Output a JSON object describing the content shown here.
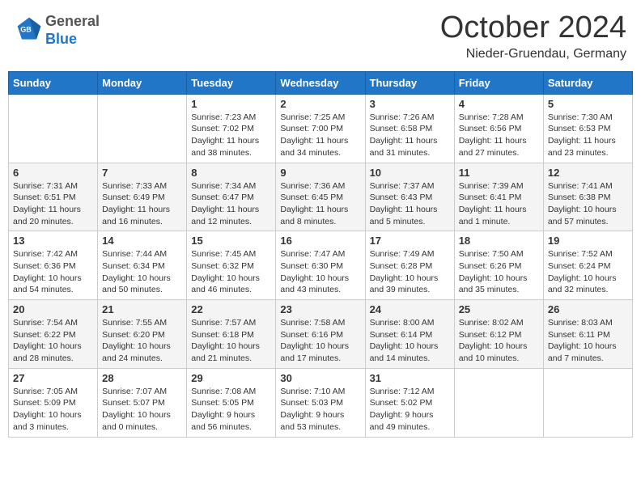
{
  "header": {
    "logo_text_general": "General",
    "logo_text_blue": "Blue",
    "month_title": "October 2024",
    "location": "Nieder-Gruendau, Germany"
  },
  "weekdays": [
    "Sunday",
    "Monday",
    "Tuesday",
    "Wednesday",
    "Thursday",
    "Friday",
    "Saturday"
  ],
  "weeks": [
    [
      {
        "day": "",
        "text": ""
      },
      {
        "day": "",
        "text": ""
      },
      {
        "day": "1",
        "text": "Sunrise: 7:23 AM\nSunset: 7:02 PM\nDaylight: 11 hours and 38 minutes."
      },
      {
        "day": "2",
        "text": "Sunrise: 7:25 AM\nSunset: 7:00 PM\nDaylight: 11 hours and 34 minutes."
      },
      {
        "day": "3",
        "text": "Sunrise: 7:26 AM\nSunset: 6:58 PM\nDaylight: 11 hours and 31 minutes."
      },
      {
        "day": "4",
        "text": "Sunrise: 7:28 AM\nSunset: 6:56 PM\nDaylight: 11 hours and 27 minutes."
      },
      {
        "day": "5",
        "text": "Sunrise: 7:30 AM\nSunset: 6:53 PM\nDaylight: 11 hours and 23 minutes."
      }
    ],
    [
      {
        "day": "6",
        "text": "Sunrise: 7:31 AM\nSunset: 6:51 PM\nDaylight: 11 hours and 20 minutes."
      },
      {
        "day": "7",
        "text": "Sunrise: 7:33 AM\nSunset: 6:49 PM\nDaylight: 11 hours and 16 minutes."
      },
      {
        "day": "8",
        "text": "Sunrise: 7:34 AM\nSunset: 6:47 PM\nDaylight: 11 hours and 12 minutes."
      },
      {
        "day": "9",
        "text": "Sunrise: 7:36 AM\nSunset: 6:45 PM\nDaylight: 11 hours and 8 minutes."
      },
      {
        "day": "10",
        "text": "Sunrise: 7:37 AM\nSunset: 6:43 PM\nDaylight: 11 hours and 5 minutes."
      },
      {
        "day": "11",
        "text": "Sunrise: 7:39 AM\nSunset: 6:41 PM\nDaylight: 11 hours and 1 minute."
      },
      {
        "day": "12",
        "text": "Sunrise: 7:41 AM\nSunset: 6:38 PM\nDaylight: 10 hours and 57 minutes."
      }
    ],
    [
      {
        "day": "13",
        "text": "Sunrise: 7:42 AM\nSunset: 6:36 PM\nDaylight: 10 hours and 54 minutes."
      },
      {
        "day": "14",
        "text": "Sunrise: 7:44 AM\nSunset: 6:34 PM\nDaylight: 10 hours and 50 minutes."
      },
      {
        "day": "15",
        "text": "Sunrise: 7:45 AM\nSunset: 6:32 PM\nDaylight: 10 hours and 46 minutes."
      },
      {
        "day": "16",
        "text": "Sunrise: 7:47 AM\nSunset: 6:30 PM\nDaylight: 10 hours and 43 minutes."
      },
      {
        "day": "17",
        "text": "Sunrise: 7:49 AM\nSunset: 6:28 PM\nDaylight: 10 hours and 39 minutes."
      },
      {
        "day": "18",
        "text": "Sunrise: 7:50 AM\nSunset: 6:26 PM\nDaylight: 10 hours and 35 minutes."
      },
      {
        "day": "19",
        "text": "Sunrise: 7:52 AM\nSunset: 6:24 PM\nDaylight: 10 hours and 32 minutes."
      }
    ],
    [
      {
        "day": "20",
        "text": "Sunrise: 7:54 AM\nSunset: 6:22 PM\nDaylight: 10 hours and 28 minutes."
      },
      {
        "day": "21",
        "text": "Sunrise: 7:55 AM\nSunset: 6:20 PM\nDaylight: 10 hours and 24 minutes."
      },
      {
        "day": "22",
        "text": "Sunrise: 7:57 AM\nSunset: 6:18 PM\nDaylight: 10 hours and 21 minutes."
      },
      {
        "day": "23",
        "text": "Sunrise: 7:58 AM\nSunset: 6:16 PM\nDaylight: 10 hours and 17 minutes."
      },
      {
        "day": "24",
        "text": "Sunrise: 8:00 AM\nSunset: 6:14 PM\nDaylight: 10 hours and 14 minutes."
      },
      {
        "day": "25",
        "text": "Sunrise: 8:02 AM\nSunset: 6:12 PM\nDaylight: 10 hours and 10 minutes."
      },
      {
        "day": "26",
        "text": "Sunrise: 8:03 AM\nSunset: 6:11 PM\nDaylight: 10 hours and 7 minutes."
      }
    ],
    [
      {
        "day": "27",
        "text": "Sunrise: 7:05 AM\nSunset: 5:09 PM\nDaylight: 10 hours and 3 minutes."
      },
      {
        "day": "28",
        "text": "Sunrise: 7:07 AM\nSunset: 5:07 PM\nDaylight: 10 hours and 0 minutes."
      },
      {
        "day": "29",
        "text": "Sunrise: 7:08 AM\nSunset: 5:05 PM\nDaylight: 9 hours and 56 minutes."
      },
      {
        "day": "30",
        "text": "Sunrise: 7:10 AM\nSunset: 5:03 PM\nDaylight: 9 hours and 53 minutes."
      },
      {
        "day": "31",
        "text": "Sunrise: 7:12 AM\nSunset: 5:02 PM\nDaylight: 9 hours and 49 minutes."
      },
      {
        "day": "",
        "text": ""
      },
      {
        "day": "",
        "text": ""
      }
    ]
  ]
}
